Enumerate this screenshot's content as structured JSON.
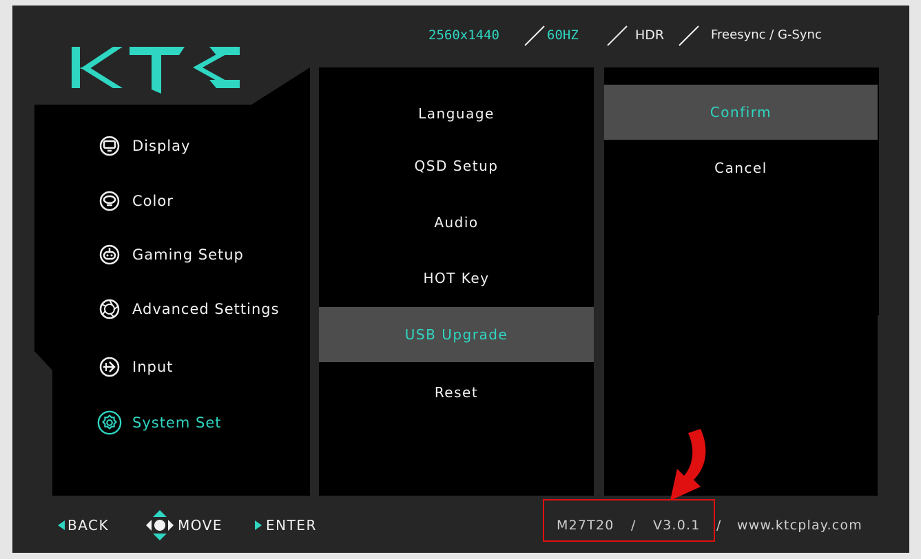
{
  "brand": {
    "logo_text": "KTC",
    "accent_color": "#2fd6c2"
  },
  "specs": {
    "resolution": "2560x1440",
    "refresh": "60HZ",
    "hdr": "HDR",
    "sync": "Freesync / G-Sync"
  },
  "main_menu": {
    "items": [
      {
        "label": "Display",
        "icon": "monitor-icon"
      },
      {
        "label": "Color",
        "icon": "color-icon"
      },
      {
        "label": "Gaming Setup",
        "icon": "gamepad-icon"
      },
      {
        "label": "Advanced Settings",
        "icon": "aperture-icon"
      },
      {
        "label": "Input",
        "icon": "input-arrow-icon"
      },
      {
        "label": "System Set",
        "icon": "gear-icon",
        "active": true
      }
    ]
  },
  "submenu": {
    "items": [
      {
        "label": "Language"
      },
      {
        "label": "QSD Setup"
      },
      {
        "label": "Audio"
      },
      {
        "label": "HOT Key"
      },
      {
        "label": "USB Upgrade",
        "active": true
      },
      {
        "label": "Reset"
      }
    ]
  },
  "options": {
    "items": [
      {
        "label": "Confirm",
        "active": true
      },
      {
        "label": "Cancel"
      }
    ]
  },
  "footer": {
    "back": "BACK",
    "move": "MOVE",
    "enter": "ENTER",
    "model": "M27T20",
    "separator": "/",
    "version": "V3.0.1",
    "website": "www.ktcplay.com"
  },
  "annotation": {
    "highlight_color": "#e01010",
    "arrow_icon": "curved-down-arrow-icon"
  }
}
